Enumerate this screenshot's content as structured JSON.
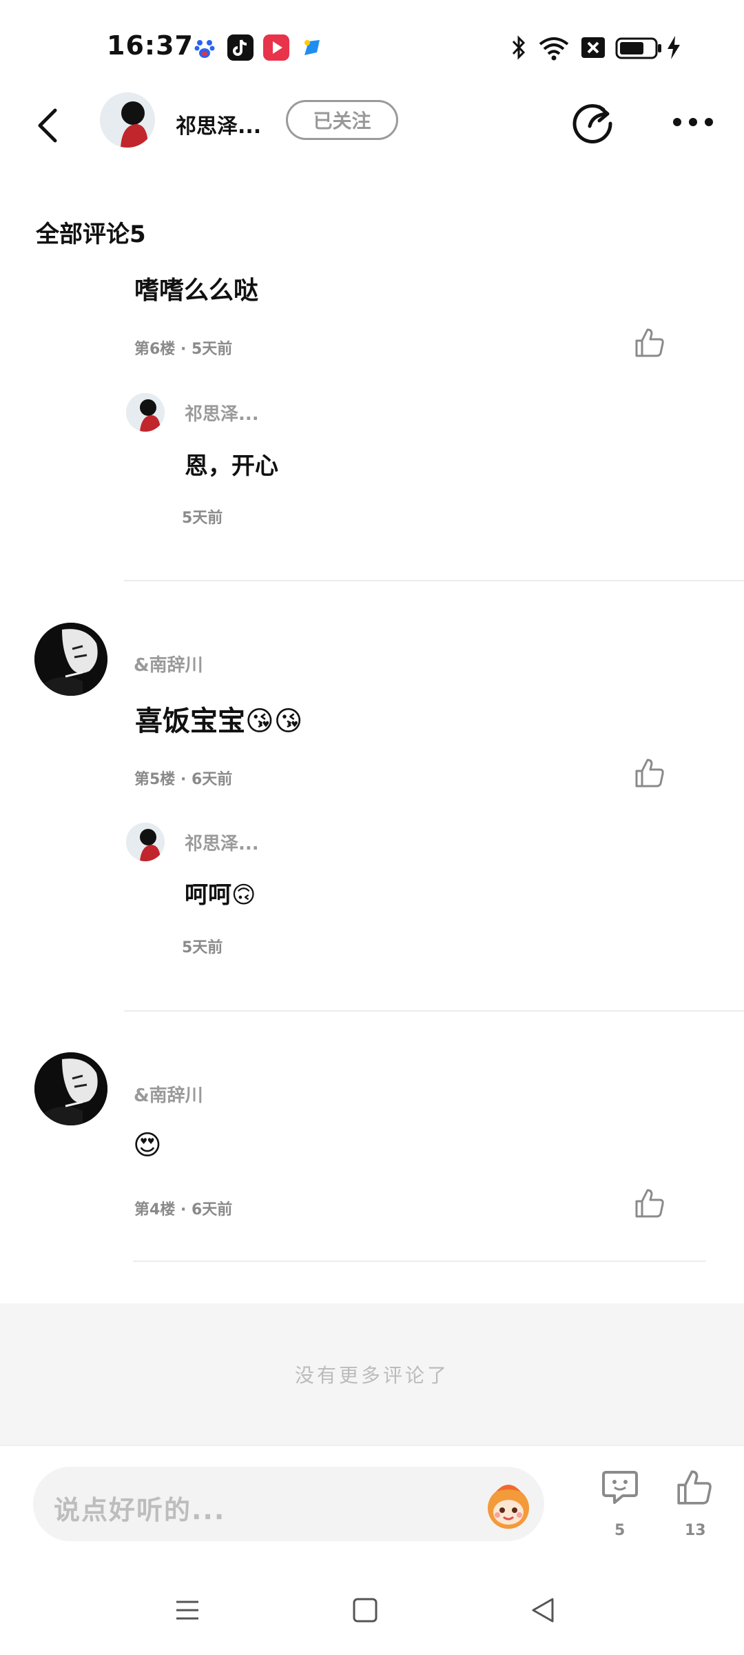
{
  "status_bar": {
    "time": "16:37",
    "apps": [
      "baidu-app-icon",
      "tiktok-app-icon",
      "video-app-icon",
      "blue-app-icon"
    ],
    "icons": [
      "bluetooth-icon",
      "wifi-icon",
      "sim-off-icon",
      "battery-icon",
      "charging-icon"
    ]
  },
  "header": {
    "author_name": "祁思泽...",
    "follow_label": "已关注"
  },
  "section_title": "全部评论5",
  "partial_comment": {
    "text": "嗜嗜么么哒",
    "meta": "第6楼 · 5天前"
  },
  "comments": [
    {
      "reply": {
        "name": "祁思泽...",
        "text": "恩，开心",
        "time": "5天前"
      }
    },
    {
      "name": "&南辞川",
      "text": "喜饭宝宝😘😘",
      "meta": "第5楼 · 6天前",
      "reply": {
        "name": "祁思泽...",
        "text": "呵呵🙃",
        "time": "5天前"
      }
    },
    {
      "name": "&南辞川",
      "text": "😍",
      "meta": "第4楼 · 6天前"
    }
  ],
  "no_more_text": "没有更多评论了",
  "bottom_bar": {
    "input_placeholder": "说点好听的...",
    "comment_count": "5",
    "like_count": "13"
  }
}
